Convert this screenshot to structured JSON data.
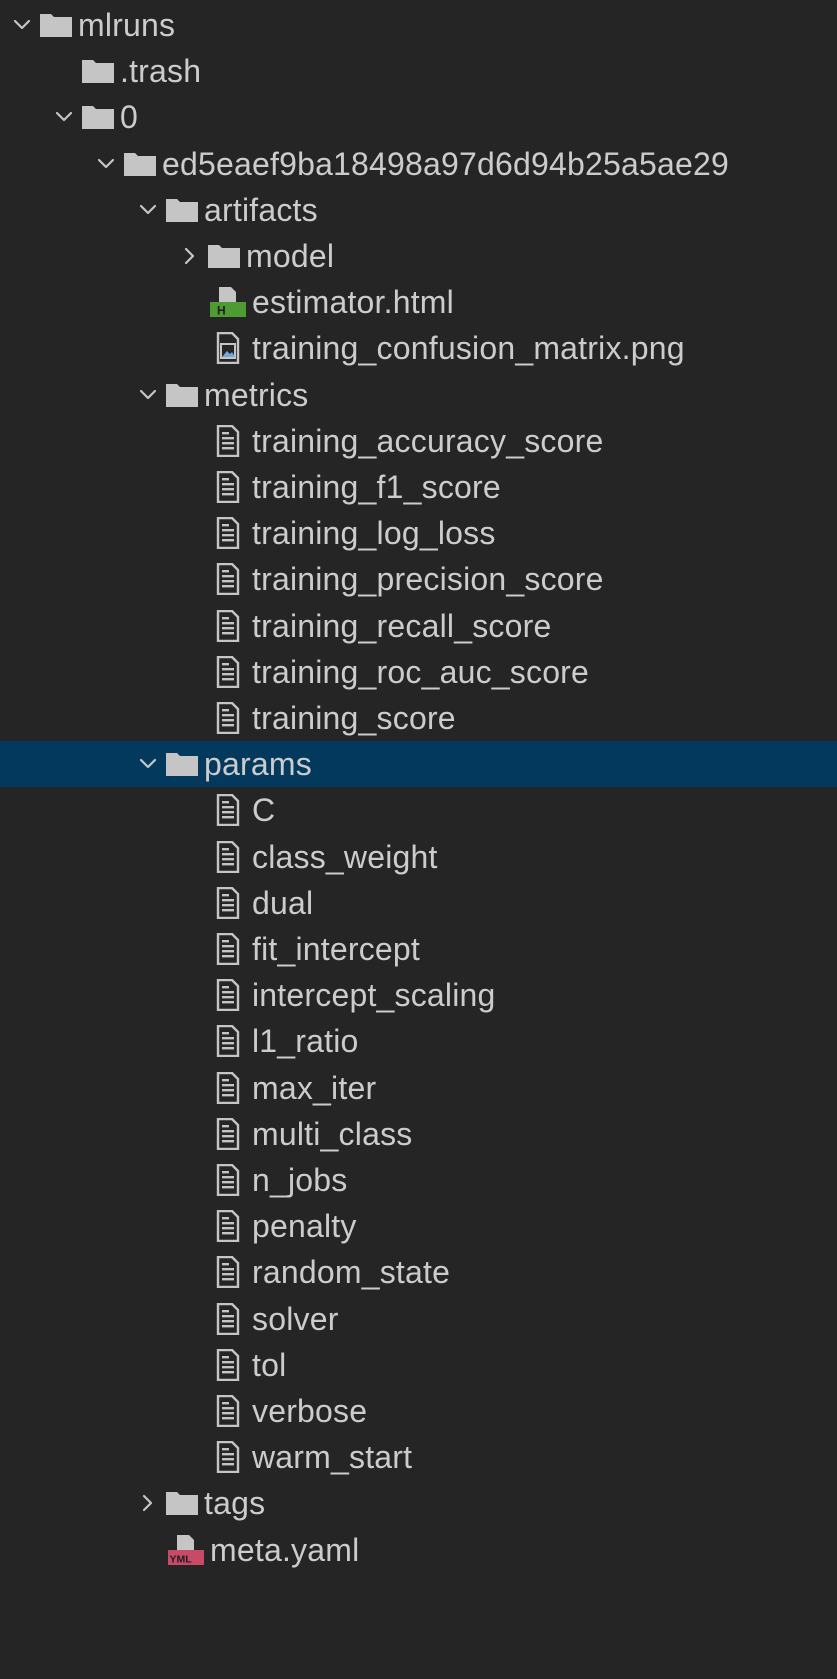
{
  "explorer": {
    "items": [
      {
        "label": "mlruns",
        "type": "folder",
        "depth": 0,
        "expanded": true,
        "icon": "folder-icon"
      },
      {
        "label": ".trash",
        "type": "folder",
        "depth": 1,
        "expanded": null,
        "icon": "folder-icon"
      },
      {
        "label": "0",
        "type": "folder",
        "depth": 1,
        "expanded": true,
        "icon": "folder-icon"
      },
      {
        "label": "ed5eaef9ba18498a97d6d94b25a5ae29",
        "type": "folder",
        "depth": 2,
        "expanded": true,
        "icon": "folder-icon"
      },
      {
        "label": "artifacts",
        "type": "folder",
        "depth": 3,
        "expanded": true,
        "icon": "folder-icon"
      },
      {
        "label": "model",
        "type": "folder",
        "depth": 4,
        "expanded": false,
        "icon": "folder-icon"
      },
      {
        "label": "estimator.html",
        "type": "file",
        "depth": 4,
        "icon": "html-file-icon"
      },
      {
        "label": "training_confusion_matrix.png",
        "type": "file",
        "depth": 4,
        "icon": "image-file-icon"
      },
      {
        "label": "metrics",
        "type": "folder",
        "depth": 3,
        "expanded": true,
        "icon": "folder-icon"
      },
      {
        "label": "training_accuracy_score",
        "type": "file",
        "depth": 4,
        "icon": "text-file-icon"
      },
      {
        "label": "training_f1_score",
        "type": "file",
        "depth": 4,
        "icon": "text-file-icon"
      },
      {
        "label": "training_log_loss",
        "type": "file",
        "depth": 4,
        "icon": "text-file-icon"
      },
      {
        "label": "training_precision_score",
        "type": "file",
        "depth": 4,
        "icon": "text-file-icon"
      },
      {
        "label": "training_recall_score",
        "type": "file",
        "depth": 4,
        "icon": "text-file-icon"
      },
      {
        "label": "training_roc_auc_score",
        "type": "file",
        "depth": 4,
        "icon": "text-file-icon"
      },
      {
        "label": "training_score",
        "type": "file",
        "depth": 4,
        "icon": "text-file-icon"
      },
      {
        "label": "params",
        "type": "folder",
        "depth": 3,
        "expanded": true,
        "selected": true,
        "icon": "folder-icon"
      },
      {
        "label": "C",
        "type": "file",
        "depth": 4,
        "icon": "text-file-icon"
      },
      {
        "label": "class_weight",
        "type": "file",
        "depth": 4,
        "icon": "text-file-icon"
      },
      {
        "label": "dual",
        "type": "file",
        "depth": 4,
        "icon": "text-file-icon"
      },
      {
        "label": "fit_intercept",
        "type": "file",
        "depth": 4,
        "icon": "text-file-icon"
      },
      {
        "label": "intercept_scaling",
        "type": "file",
        "depth": 4,
        "icon": "text-file-icon"
      },
      {
        "label": "l1_ratio",
        "type": "file",
        "depth": 4,
        "icon": "text-file-icon"
      },
      {
        "label": "max_iter",
        "type": "file",
        "depth": 4,
        "icon": "text-file-icon"
      },
      {
        "label": "multi_class",
        "type": "file",
        "depth": 4,
        "icon": "text-file-icon"
      },
      {
        "label": "n_jobs",
        "type": "file",
        "depth": 4,
        "icon": "text-file-icon"
      },
      {
        "label": "penalty",
        "type": "file",
        "depth": 4,
        "icon": "text-file-icon"
      },
      {
        "label": "random_state",
        "type": "file",
        "depth": 4,
        "icon": "text-file-icon"
      },
      {
        "label": "solver",
        "type": "file",
        "depth": 4,
        "icon": "text-file-icon"
      },
      {
        "label": "tol",
        "type": "file",
        "depth": 4,
        "icon": "text-file-icon"
      },
      {
        "label": "verbose",
        "type": "file",
        "depth": 4,
        "icon": "text-file-icon"
      },
      {
        "label": "warm_start",
        "type": "file",
        "depth": 4,
        "icon": "text-file-icon"
      },
      {
        "label": "tags",
        "type": "folder",
        "depth": 3,
        "expanded": false,
        "icon": "folder-icon"
      },
      {
        "label": "meta.yaml",
        "type": "file",
        "depth": 3,
        "icon": "yaml-file-icon"
      }
    ]
  },
  "colors": {
    "background": "#252526",
    "selected_row": "#04395e",
    "text": "#cccccc",
    "icon": "#c5c5c5",
    "html_badge": "#4e9a33",
    "yaml_badge": "#c94a67"
  }
}
